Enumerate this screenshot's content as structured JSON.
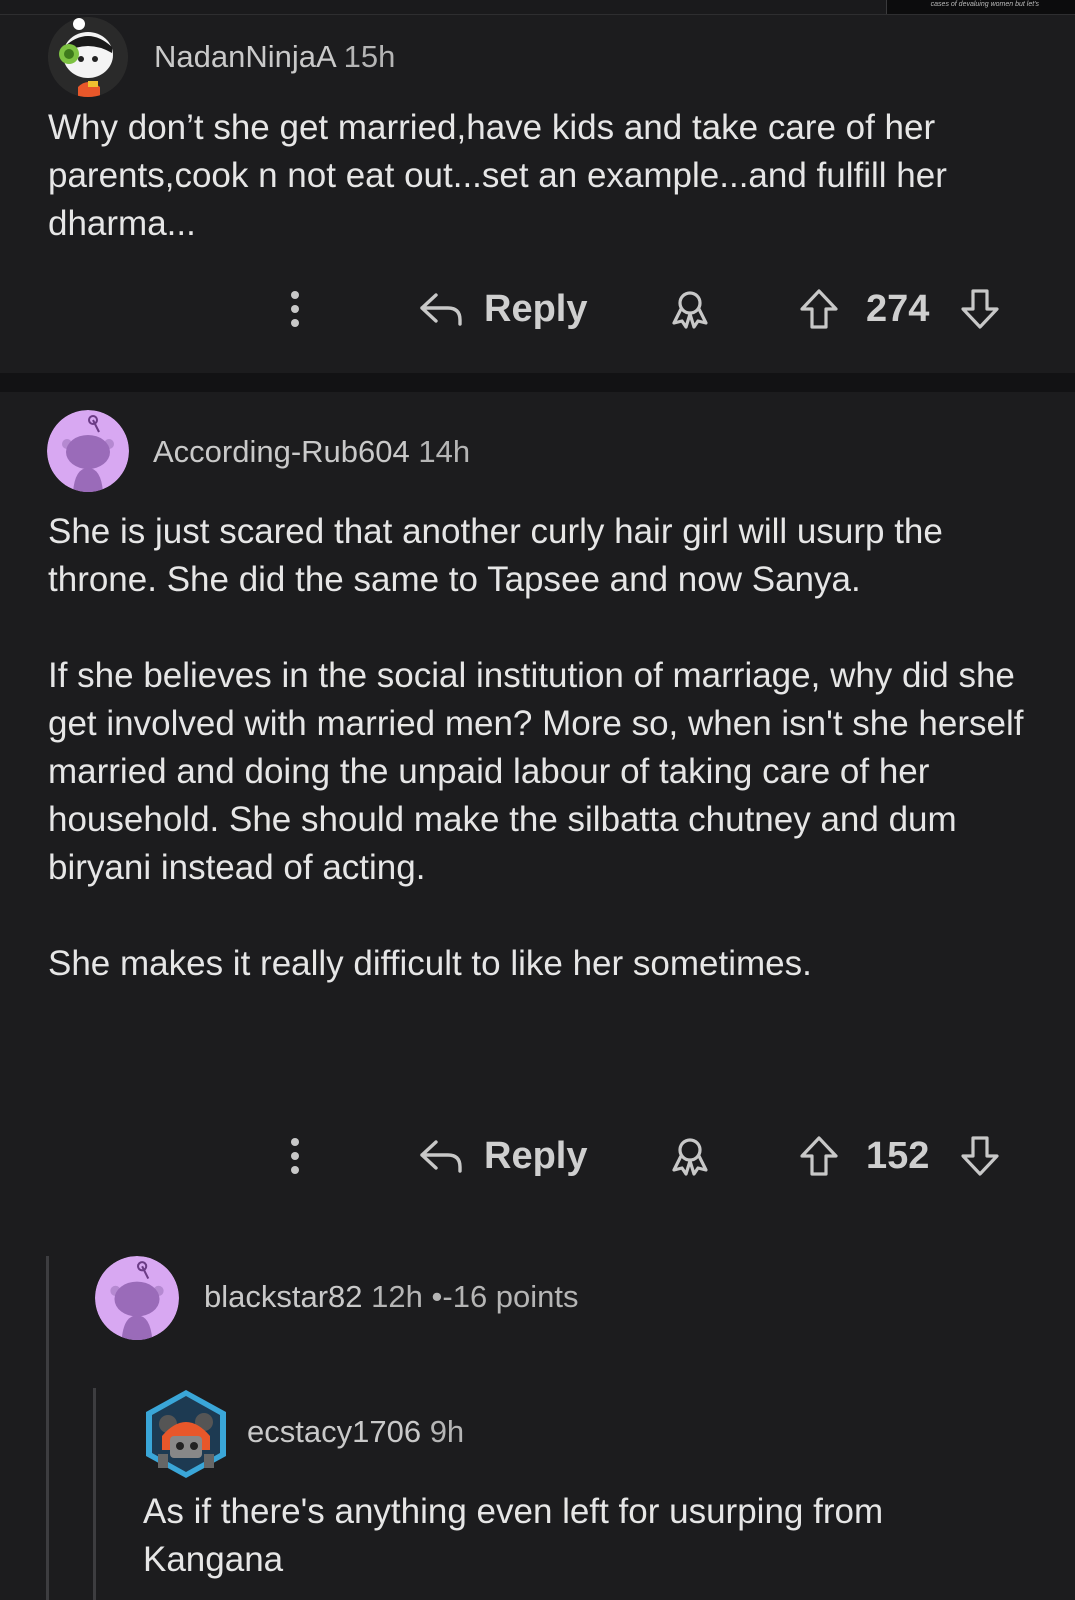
{
  "top_strip": {
    "text": "cases of devaluing women but let's"
  },
  "comments": [
    {
      "username": "NadanNinjaA",
      "age": "15h",
      "body": [
        "Why don’t she get married,have kids and take care of her parents,cook n not eat out...set an example...and fulfill her dharma..."
      ],
      "reply_label": "Reply",
      "score": "274"
    },
    {
      "username": "According-Rub604",
      "age": "14h",
      "body": [
        "She is just scared that another curly hair girl will usurp the throne. She did the same to Tapsee and now Sanya.",
        "If she believes in the social institution of marriage, why did she get involved with married men? More so, when isn't she herself married and doing the unpaid labour of taking care of her household. She should make the silbatta chutney and dum biryani instead of acting.",
        "She makes it really difficult to like her sometimes."
      ],
      "reply_label": "Reply",
      "score": "152"
    },
    {
      "username": "blackstar82",
      "age": "12h",
      "separator": "•",
      "points": "-16 points"
    },
    {
      "username": "ecstacy1706",
      "age": "9h",
      "body": [
        "As if there's anything even left for usurping from Kangana"
      ]
    }
  ],
  "icons": {
    "more": "more-vertical-icon",
    "reply": "reply-arrow-icon",
    "award": "award-icon",
    "upvote": "upvote-icon",
    "downvote": "downvote-icon"
  },
  "colors": {
    "background": "#121214",
    "card": "#1c1c1e",
    "snoo_avatar_bg": "#d8a8f2"
  }
}
